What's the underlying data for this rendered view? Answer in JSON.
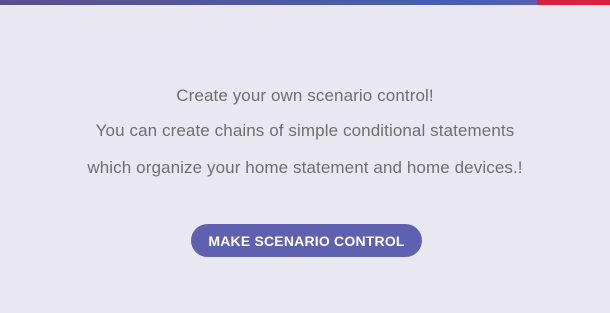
{
  "intro": {
    "line1": "Create your own scenario control!",
    "line2": "You can create chains of simple conditional statements",
    "line3": "which organize your home statement and home devices.!"
  },
  "actions": {
    "make_scenario_control_label": "MAKE SCENARIO CONTROL"
  },
  "colors": {
    "background": "#e9e8f0",
    "text": "#6f6f72",
    "button": "#5f60b0",
    "accent_red": "#d9223a"
  }
}
